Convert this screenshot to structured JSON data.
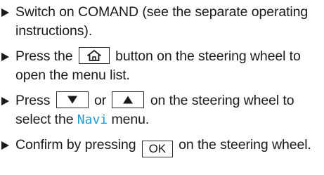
{
  "steps": {
    "step1": {
      "text": "Switch on COMAND (see the separate operating instructions)."
    },
    "step2": {
      "before": "Press the",
      "key_icon": "home-icon",
      "after": "button on the steering wheel to open the menu list."
    },
    "step3": {
      "before": "Press",
      "key1_icon": "arrow-down-icon",
      "middle": "or",
      "key2_icon": "arrow-up-icon",
      "after1": "on the steering wheel to select the",
      "menu_name": "Navi",
      "after2": "menu."
    },
    "step4": {
      "before": "Confirm by pressing",
      "key_label": "OK",
      "after": "on the steering wheel."
    }
  },
  "colors": {
    "text": "#1a1a1a",
    "menu_highlight": "#1f9bd7"
  }
}
